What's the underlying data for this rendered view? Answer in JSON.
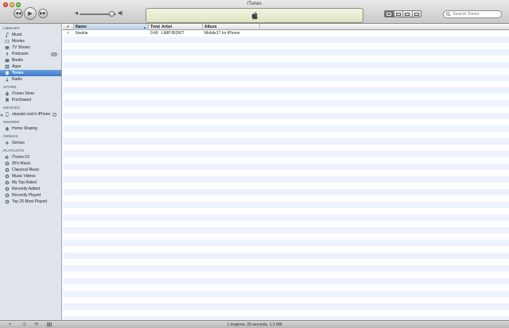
{
  "window": {
    "title": "iTunes"
  },
  "search": {
    "placeholder": "Search Tones"
  },
  "sidebar": {
    "library": {
      "header": "LIBRARY",
      "items": [
        {
          "label": "Music",
          "icon": "music-note-icon"
        },
        {
          "label": "Movies",
          "icon": "film-icon"
        },
        {
          "label": "TV Shows",
          "icon": "tv-icon"
        },
        {
          "label": "Podcasts",
          "icon": "podcast-icon",
          "badge": "4"
        },
        {
          "label": "Books",
          "icon": "book-icon"
        },
        {
          "label": "Apps",
          "icon": "apps-icon"
        },
        {
          "label": "Tones",
          "icon": "bell-icon",
          "selected": true
        },
        {
          "label": "Radio",
          "icon": "radio-icon"
        }
      ]
    },
    "store": {
      "header": "STORE",
      "items": [
        {
          "label": "iTunes Store",
          "icon": "store-icon"
        },
        {
          "label": "Purchased",
          "icon": "purchased-icon"
        }
      ]
    },
    "devices": {
      "header": "DEVICES",
      "items": [
        {
          "label": "okazaki rock's iPhone",
          "icon": "iphone-icon"
        }
      ]
    },
    "shared": {
      "header": "SHARED",
      "items": [
        {
          "label": "Home Sharing",
          "icon": "home-icon"
        }
      ]
    },
    "genius": {
      "header": "GENIUS",
      "items": [
        {
          "label": "Genius",
          "icon": "genius-icon"
        }
      ]
    },
    "playlists": {
      "header": "PLAYLISTS",
      "items": [
        {
          "label": "iTunes DJ",
          "icon": "dj-icon"
        },
        {
          "label": "90's Music",
          "icon": "smart-playlist-icon"
        },
        {
          "label": "Classical Music",
          "icon": "smart-playlist-icon"
        },
        {
          "label": "Music Videos",
          "icon": "smart-playlist-icon"
        },
        {
          "label": "My Top Rated",
          "icon": "smart-playlist-icon"
        },
        {
          "label": "Recently Added",
          "icon": "smart-playlist-icon"
        },
        {
          "label": "Recently Played",
          "icon": "smart-playlist-icon"
        },
        {
          "label": "Top 25 Most Played",
          "icon": "smart-playlist-icon"
        }
      ]
    }
  },
  "table": {
    "columns": {
      "check": "✓",
      "name": "Name",
      "time": "Time",
      "artist": "Artist",
      "album": "Album"
    },
    "rows": [
      {
        "check": "✓",
        "name": "Nookie",
        "time": "0:40",
        "artist": "LIMP BIZKIT",
        "album": "Mobile17 for iPhone"
      }
    ]
  },
  "status": {
    "text": "1 ringtone, 39 seconds, 1.3 MB"
  },
  "colors": {
    "selection": "#3d79c8",
    "sidebar_bg": "#dee4ea",
    "stripe": "#edf3fe",
    "lcd": "#e8ecd2"
  }
}
